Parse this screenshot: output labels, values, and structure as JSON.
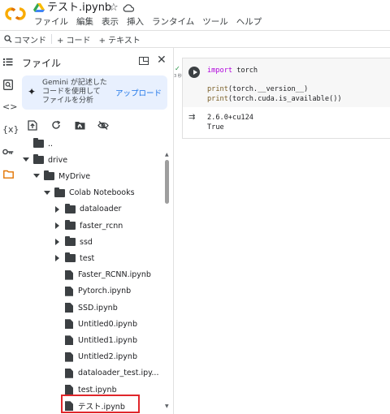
{
  "header": {
    "notebook_title": "テスト.ipynb",
    "menu": [
      "ファイル",
      "編集",
      "表示",
      "挿入",
      "ランタイム",
      "ツール",
      "ヘルプ"
    ],
    "brand_colors": {
      "logo_orange": "#f9ab00",
      "logo_dark_orange": "#e37400"
    }
  },
  "toolbar": {
    "command_label": "コマンド",
    "add_code_label": "+ コード",
    "add_text_label": "+ テキスト"
  },
  "rail": {
    "icons": [
      "table-of-contents-icon",
      "find-icon",
      "code-snippets-icon",
      "variables-icon",
      "secrets-key-icon",
      "files-folder-icon"
    ],
    "variables_glyph": "{x}",
    "code_glyph": "<>"
  },
  "files_panel": {
    "title": "ファイル",
    "gemini": {
      "line1": "Gemini が記述した",
      "line2": "コードを使用して",
      "line3": "ファイルを分析",
      "upload_label": "アップロード"
    },
    "tree": [
      {
        "label": "..",
        "type": "folder",
        "depth": 0,
        "expanded": null
      },
      {
        "label": "drive",
        "type": "folder",
        "depth": 0,
        "expanded": true
      },
      {
        "label": "MyDrive",
        "type": "folder",
        "depth": 1,
        "expanded": true
      },
      {
        "label": "Colab Notebooks",
        "type": "folder",
        "depth": 2,
        "expanded": true
      },
      {
        "label": "dataloader",
        "type": "folder",
        "depth": 3,
        "expanded": false
      },
      {
        "label": "faster_rcnn",
        "type": "folder",
        "depth": 3,
        "expanded": false
      },
      {
        "label": "ssd",
        "type": "folder",
        "depth": 3,
        "expanded": false
      },
      {
        "label": "test",
        "type": "folder",
        "depth": 3,
        "expanded": false
      },
      {
        "label": "Faster_RCNN.ipynb",
        "type": "file",
        "depth": 3
      },
      {
        "label": "Pytorch.ipynb",
        "type": "file",
        "depth": 3
      },
      {
        "label": "SSD.ipynb",
        "type": "file",
        "depth": 3
      },
      {
        "label": "Untitled0.ipynb",
        "type": "file",
        "depth": 3
      },
      {
        "label": "Untitled1.ipynb",
        "type": "file",
        "depth": 3
      },
      {
        "label": "Untitled2.ipynb",
        "type": "file",
        "depth": 3
      },
      {
        "label": "dataloader_test.ipy...",
        "type": "file",
        "depth": 3
      },
      {
        "label": "test.ipynb",
        "type": "file",
        "depth": 3
      },
      {
        "label": "テスト.ipynb",
        "type": "file",
        "depth": 3,
        "highlighted": true
      }
    ],
    "highlight_color": "#e0262b"
  },
  "cell": {
    "exec_status": "✓",
    "exec_time": "3 秒",
    "code_lines": [
      "import torch",
      "",
      "print(torch.__version__)",
      "print(torch.cuda.is_available())"
    ],
    "output_lines": [
      "2.6.0+cu124",
      "True"
    ]
  }
}
